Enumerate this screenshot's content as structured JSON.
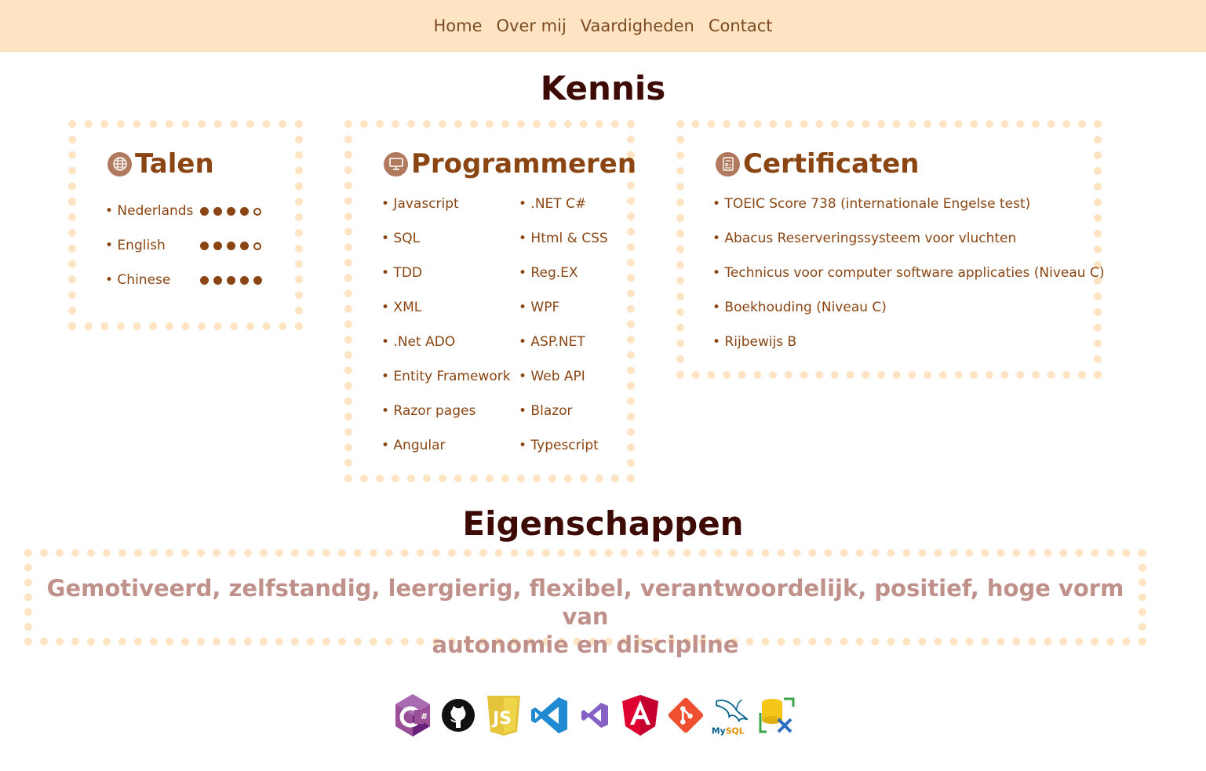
{
  "nav": [
    "Home",
    "Over mij",
    "Vaardigheden",
    "Contact"
  ],
  "kennis_title": "Kennis",
  "talen": {
    "title": "Talen",
    "icon": "globe-icon",
    "items": [
      {
        "label": "• Nederlands",
        "level": 4,
        "max": 5
      },
      {
        "label": "• English",
        "level": 4,
        "max": 5
      },
      {
        "label": "• Chinese",
        "level": 5,
        "max": 5
      }
    ]
  },
  "programmeren": {
    "title": "Programmeren",
    "icon": "monitor-icon",
    "left": [
      "• Javascript",
      "• SQL",
      "• TDD",
      "• XML",
      "• .Net ADO",
      "• Entity Framework",
      "• Razor pages",
      "• Angular"
    ],
    "right": [
      "• .NET C#",
      "• Html & CSS",
      "• Reg.EX",
      "• WPF",
      "• ASP.NET",
      "• Web API",
      "• Blazor",
      "• Typescript"
    ]
  },
  "certificaten": {
    "title": "Certificaten",
    "icon": "certificate-icon",
    "items": [
      "• TOEIC Score 738 (internationale Engelse test)",
      "• Abacus Reserveringssysteem voor vluchten",
      "• Technicus voor computer software applicaties (Niveau C)",
      "• Boekhouding (Niveau C)",
      "• Rijbewijs B"
    ]
  },
  "eigenschappen_title": "Eigenschappen",
  "eigenschappen": {
    "line1": "Gemotiveerd, zelfstandig, leergierig, flexibel, verantwoordelijk, positief, hoge vorm van",
    "line2": "autonomie en discipline"
  },
  "tools": [
    "csharp-icon",
    "github-icon",
    "javascript-icon",
    "vscode-icon",
    "visual-studio-icon",
    "angular-icon",
    "git-icon",
    "mysql-icon",
    "sql-server-tools-icon"
  ],
  "colors": {
    "nav_bg": "#ffe4c4",
    "accent": "#8b4513",
    "title": "#3d0a05",
    "traits": "#c0908a"
  }
}
